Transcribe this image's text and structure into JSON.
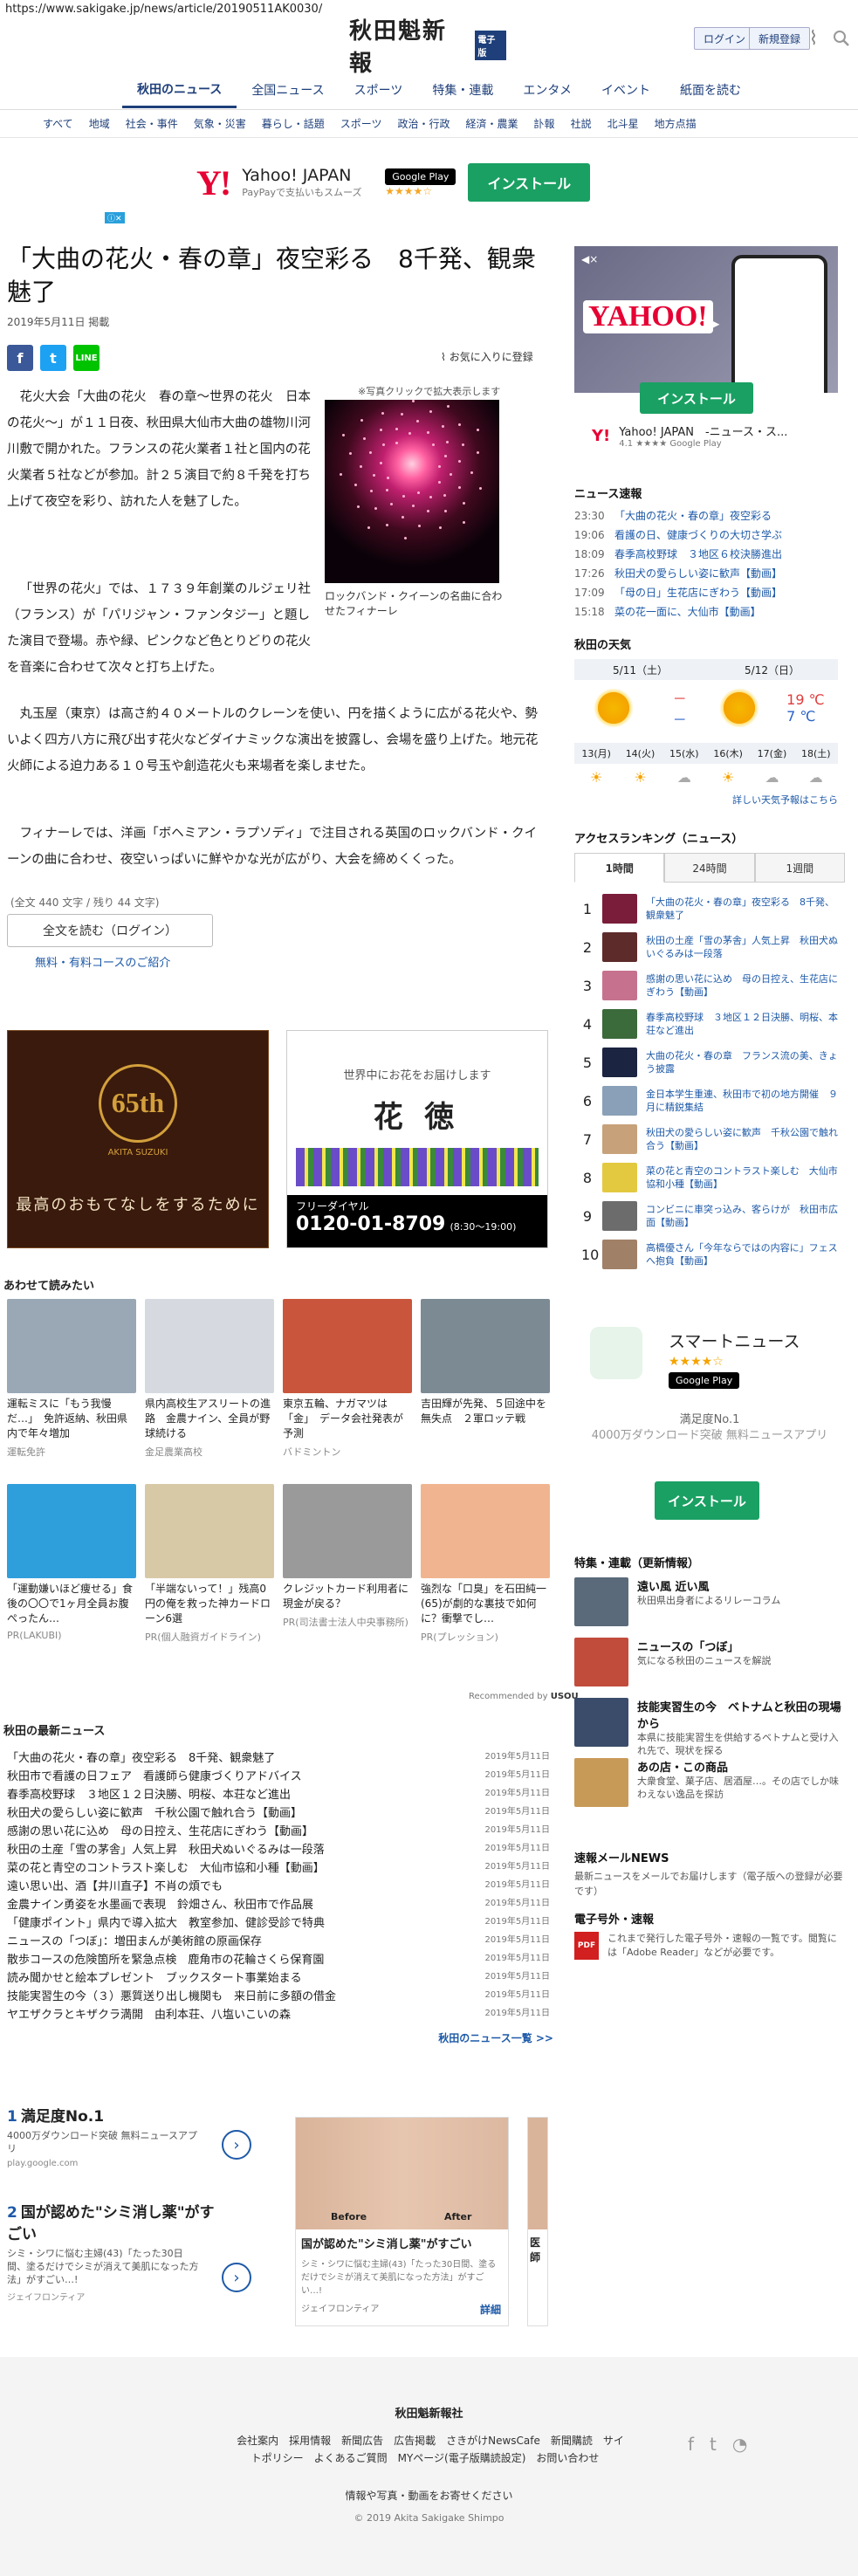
{
  "url": "https://www.sakigake.jp/news/article/20190511AK0030/",
  "header": {
    "logo": "秋田魁新報",
    "logo_badge": "電子版",
    "login": "ログイン",
    "register": "新規登録",
    "nav": [
      "秋田のニュース",
      "全国ニュース",
      "スポーツ",
      "特集・連載",
      "エンタメ",
      "イベント",
      "紙面を読む"
    ],
    "subnav": [
      "すべて",
      "地域",
      "社会・事件",
      "気象・災害",
      "暮らし・話題",
      "スポーツ",
      "政治・行政",
      "経済・農業",
      "訃報",
      "社説",
      "北斗星",
      "地方点描"
    ]
  },
  "ad_top": {
    "brand": "Y!",
    "title": "Yahoo! JAPAN",
    "sub": "PayPayで支払いもスムーズ",
    "store": "Google Play",
    "stars": "★★★★☆",
    "button": "インストール"
  },
  "article": {
    "title": "「大曲の花火・春の章」夜空彩る　8千発、観衆魅了",
    "date": "2019年5月11日",
    "date_suffix": "掲載",
    "favorite": "お気に入りに登録",
    "photo_note": "※写真クリックで拡大表示します",
    "photo_caption": "ロックバンド・クイーンの名曲に合わせたフィナーレ",
    "p1": "花火大会「大曲の花火　春の章～世界の花火　日本の花火～」が１１日夜、秋田県大仙市大曲の雄物川河川敷で開かれた。フランスの花火業者１社と国内の花火業者５社などが参加。計２５演目で約８千発を打ち上げて夜空を彩り、訪れた人を魅了した。",
    "p2": "「世界の花火」では、１７３９年創業のルジェリ社（フランス）が「パリジャン・ファンタジー」と題した演目で登場。赤や緑、ピンクなど色とりどりの花火を音楽に合わせて次々と打ち上げた。",
    "p3": "丸玉屋（東京）は高さ約４０メートルのクレーンを使い、円を描くように広がる花火や、勢いよく四方八方に飛び出す花火などダイナミックな演出を披露し、会場を盛り上げた。地元花火師による迫力ある１０号玉や創造花火も来場者を楽しませた。",
    "p4": "フィナーレでは、洋画「ボヘミアン・ラプソディ」で注目される英国のロックバンド・クイーンの曲に合わせ、夜空いっぱいに鮮やかな光が広がり、大会を締めくくった。",
    "meta": "(全文 440 文字 / 残り 44 文字)",
    "read_full": "全文を読む（ログイン）",
    "course": "無料・有料コースのご紹介"
  },
  "ads_mid": {
    "left_num": "65th",
    "left_sub": "AKITA SUZUKI",
    "left_text": "最高のおもてなしをするために",
    "right_top": "世界中にお花をお届けします",
    "right_name": "花 徳",
    "right_tel_label": "フリーダイヤル",
    "right_tel": "0120-01-8709",
    "right_hours": "(8:30～19:00)"
  },
  "reco": {
    "title": "あわせて読みたい",
    "row1": [
      {
        "t": "運転ミスに「もう我慢だ…」　免許返納、秋田県内で年々増加",
        "s": "運転免許",
        "c": "#9aa7b5"
      },
      {
        "t": "県内高校生アスリートの進路　金農ナイン、全員が野球続ける",
        "s": "金足農業高校",
        "c": "#d6dae0"
      },
      {
        "t": "東京五輪、ナガマツは「金」　データ会社発表が予測",
        "s": "バドミントン",
        "c": "#c9563c"
      },
      {
        "t": "吉田輝が先発、５回途中を無失点　２軍ロッテ戦",
        "s": "",
        "c": "#7c8a94"
      }
    ],
    "row2": [
      {
        "t": "「運動嫌いほど痩せる」食後の〇〇で1ヶ月全員お腹ぺったん…",
        "s": "PR(LAKUBI)",
        "c": "#2f9fdc"
      },
      {
        "t": "「半端ないって！」残高0円の俺を救った神カードローン6選",
        "s": "PR(個人融資ガイドライン)",
        "c": "#d8c9a6"
      },
      {
        "t": "クレジットカード利用者に現金が戻る？",
        "s": "PR(司法書士法人中央事務所)",
        "c": "#9a9a9a"
      },
      {
        "t": "強烈な「口臭」を石田純一(65)が劇的な裏技で如何に？衝撃でし…",
        "s": "PR(プレッション)",
        "c": "#f0b590"
      }
    ],
    "powered": "Recommended by",
    "powered_brand": "USOU"
  },
  "latest": {
    "title": "秋田の最新ニュース",
    "items": [
      {
        "t": "「大曲の花火・春の章」夜空彩る　8千発、観衆魅了",
        "d": "2019年5月11日"
      },
      {
        "t": "秋田市で看護の日フェア　看護師ら健康づくりアドバイス",
        "d": "2019年5月11日"
      },
      {
        "t": "春季高校野球　３地区１２日決勝、明桜、本荘など進出",
        "d": "2019年5月11日"
      },
      {
        "t": "秋田犬の愛らしい姿に歓声　千秋公園で触れ合う【動画】",
        "d": "2019年5月11日"
      },
      {
        "t": "感謝の思い花に込め　母の日控え、生花店にぎわう【動画】",
        "d": "2019年5月11日"
      },
      {
        "t": "秋田の土産「雪の茅舎」人気上昇　秋田犬ぬいぐるみは一段落",
        "d": "2019年5月11日"
      },
      {
        "t": "菜の花と青空のコントラスト楽しむ　大仙市協和小種【動画】",
        "d": "2019年5月11日"
      },
      {
        "t": "遠い思い出、酒【井川直子】不肖の煩でも",
        "d": "2019年5月11日"
      },
      {
        "t": "金農ナイン勇姿を水墨画で表現　鈴畑さん、秋田市で作品展",
        "d": "2019年5月11日"
      },
      {
        "t": "「健康ポイント」県内で導入拡大　教室参加、健診受診で特典",
        "d": "2019年5月11日"
      },
      {
        "t": "ニュースの「つぼ」：増田まんが美術館の原画保存",
        "d": "2019年5月11日"
      },
      {
        "t": "散歩コースの危険箇所を緊急点検　鹿角市の花輪さくら保育園",
        "d": "2019年5月11日"
      },
      {
        "t": "読み聞かせと絵本プレゼント　ブックスタート事業始まる",
        "d": "2019年5月11日"
      },
      {
        "t": "技能実習生の今（３）悪質送り出し機関も　来日前に多額の借金",
        "d": "2019年5月11日"
      },
      {
        "t": "ヤエザクラとキザクラ満開　由利本荘、八塩いこいの森",
        "d": "2019年5月11日"
      }
    ],
    "more": "秋田のニュース一覧 >>"
  },
  "bottom_ads": {
    "a1_num": "1",
    "a1_title": "満足度No.1",
    "a1_sub": "4000万ダウンロード突破 無料ニュースアプリ",
    "a1_url": "play.google.com",
    "a2_num": "2",
    "a2_title": "国が認めた\"シミ消し薬\"がすごい",
    "a2_sub": "シミ・シワに悩む主婦(43)「たった30日間、塗るだけでシミが消えて美肌になった方法」がすごい…!",
    "a2_url": "ジェイフロンティア",
    "img_before": "Before",
    "img_after": "After",
    "img_title": "国が認めた\"シミ消し薬\"がすごい",
    "img_sub": "シミ・シワに悩む主婦(43)「たった30日間、塗るだけでシミが消えて美肌になった方法」がすごい…!",
    "img_src": "ジェイフロンティア",
    "img_btn": "詳細",
    "img2_title": "医師"
  },
  "side": {
    "install": "インストール",
    "app_name": "Yahoo! JAPAN　-ニュース・ス...",
    "app_rating": "4.1",
    "app_store": "Google Play",
    "flash_title": "ニュース速報",
    "flash": [
      {
        "tm": "23:30",
        "tx": "「大曲の花火・春の章」夜空彩る"
      },
      {
        "tm": "19:06",
        "tx": "看護の日、健康づくりの大切さ学ぶ"
      },
      {
        "tm": "18:09",
        "tx": "春季高校野球　３地区６校決勝進出"
      },
      {
        "tm": "17:26",
        "tx": "秋田犬の愛らしい姿に歓声【動画】"
      },
      {
        "tm": "17:09",
        "tx": "「母の日」生花店にぎわう【動画】"
      },
      {
        "tm": "15:18",
        "tx": "菜の花一面に、大仙市【動画】"
      }
    ],
    "wx_title": "秋田の天気",
    "wx_day1": "5/11（土）",
    "wx_day2": "5/12（日）",
    "wx_d1_hi": "－",
    "wx_d1_lo": "－",
    "wx_d2_hi": "19 ℃",
    "wx_d2_lo": "7 ℃",
    "wx_hours": [
      "13(月)",
      "14(火)",
      "15(水)",
      "16(木)",
      "17(金)",
      "18(土)"
    ],
    "wx_more": "詳しい天気予報はこちら",
    "rank_title": "アクセスランキング（ニュース）",
    "rank_tabs": [
      "1時間",
      "24時間",
      "1週間"
    ],
    "rank": [
      {
        "n": "1",
        "t": "「大曲の花火・春の章」夜空彩る　8千発、観衆魅了",
        "c": "#7a1d3a"
      },
      {
        "n": "2",
        "t": "秋田の土産「雪の茅舎」人気上昇　秋田犬ぬいぐるみは一段落",
        "c": "#5e2b2b"
      },
      {
        "n": "3",
        "t": "感謝の思い花に込め　母の日控え、生花店にぎわう【動画】",
        "c": "#c6728e"
      },
      {
        "n": "4",
        "t": "春季高校野球　３地区１２日決勝、明桜、本荘など進出",
        "c": "#3b6a3b"
      },
      {
        "n": "5",
        "t": "大曲の花火・春の章　フランス流の美、きょう披露",
        "c": "#1b2440"
      },
      {
        "n": "6",
        "t": "金日本学生重連、秋田市で初の地方開催　９月に精鋭集結",
        "c": "#8aa0b8"
      },
      {
        "n": "7",
        "t": "秋田犬の愛らしい姿に歓声　千秋公園で触れ合う【動画】",
        "c": "#c7a17a"
      },
      {
        "n": "8",
        "t": "菜の花と青空のコントラスト楽しむ　大仙市協和小種【動画】",
        "c": "#e3c940"
      },
      {
        "n": "9",
        "t": "コンビニに車突っ込み、客らけが　秋田市広面【動画】",
        "c": "#6c6c6c"
      },
      {
        "n": "10",
        "t": "高橋優さん「今年ならではの内容に」フェスへ抱負【動画】",
        "c": "#a18068"
      }
    ],
    "smart_name": "スマートニュース",
    "smart_stars": "★★★★☆",
    "smart_store": "Google Play",
    "smart_sat": "満足度No.1",
    "smart_dl": "4000万ダウンロード突破 無料ニュースアプリ",
    "smart_btn": "インストール",
    "feat_title": "特集・連載（更新情報）",
    "feat": [
      {
        "t": "遠い風 近い風",
        "s": "秋田県出身者によるリレーコラム",
        "c": "#5a6a7a"
      },
      {
        "t": "ニュースの「つぼ」",
        "s": "気になる秋田のニュースを解説",
        "c": "#c24c3c"
      },
      {
        "t": "技能実習生の今　ベトナムと秋田の現場から",
        "s": "本県に技能実習生を供給するベトナムと受け入れ先で、現状を探る",
        "c": "#3a4c6a"
      },
      {
        "t": "あの店・この商品",
        "s": "大衆食堂、菓子店、居酒屋…。その店でしか味わえない逸品を探訪",
        "c": "#c89a58"
      }
    ],
    "mail_title": "速報メールNEWS",
    "mail_sub": "最新ニュースをメールでお届けします（電子版への登録が必要です）",
    "pdf_title": "電子号外・速報",
    "pdf_icon": "PDF",
    "pdf_sub": "これまで発行した電子号外・速報の一覧です。閲覧には「Adobe Reader」などが必要です。"
  },
  "footer": {
    "brand": "秋田魁新報社",
    "links": [
      "会社案内",
      "採用情報",
      "新聞広告",
      "広告掲載",
      "さきがけNewsCafe",
      "新聞購読",
      "サイトポリシー",
      "よくあるご質問",
      "MYページ(電子版購読設定)",
      "お問い合わせ"
    ],
    "note": "情報や写真・動画をお寄せください",
    "copy": "© 2019 Akita Sakigake Shimpo"
  }
}
